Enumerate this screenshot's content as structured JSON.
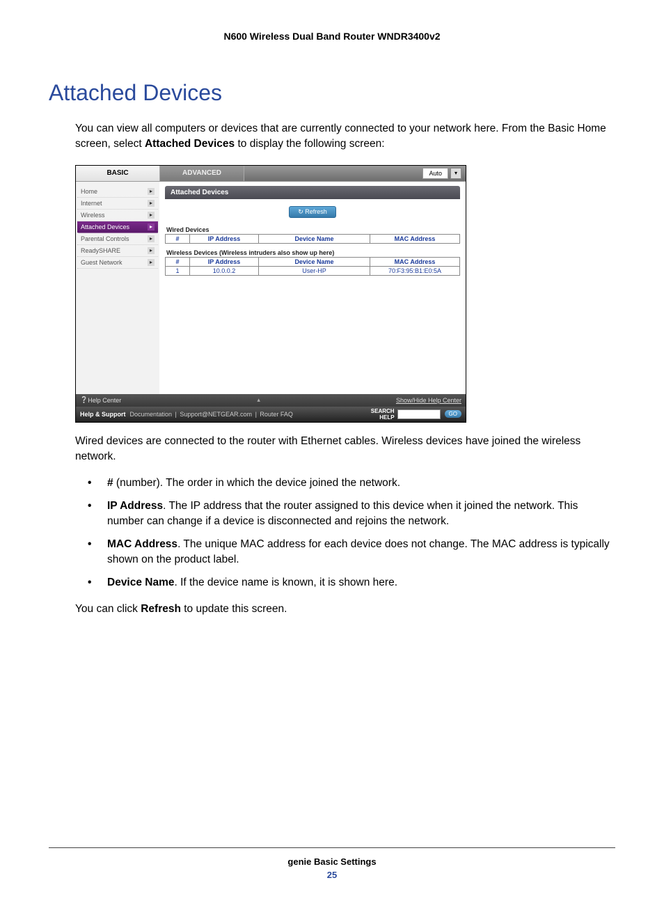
{
  "doc": {
    "header": "N600 Wireless Dual Band Router WNDR3400v2",
    "section_title": "Attached Devices",
    "intro_p1": "You can view all computers or devices that are currently connected to your network here. From the Basic Home screen, select ",
    "intro_bold": "Attached Devices",
    "intro_p2": " to display the following screen:",
    "after_fig": "Wired devices are connected to the router with Ethernet cables. Wireless devices have joined the wireless network.",
    "bullets": {
      "b1_bold": "#",
      "b1_rest": " (number). The order in which the device joined the network.",
      "b2_bold": "IP Address",
      "b2_rest": ". The IP address that the router assigned to this device when it joined the network. This number can change if a device is disconnected and rejoins the network.",
      "b3_bold": "MAC Address",
      "b3_rest": ". The unique MAC address for each device does not change. The MAC address is typically shown on the product label.",
      "b4_bold": "Device Name",
      "b4_rest": ". If the device name is known, it is shown here."
    },
    "closing_pre": "You can click ",
    "closing_bold": "Refresh",
    "closing_post": " to update this screen.",
    "footer_chapter": "genie Basic Settings",
    "footer_page": "25"
  },
  "ui": {
    "tabs": {
      "basic": "BASIC",
      "advanced": "ADVANCED"
    },
    "lang": "Auto",
    "sidebar": [
      {
        "label": "Home",
        "active": false
      },
      {
        "label": "Internet",
        "active": false
      },
      {
        "label": "Wireless",
        "active": false
      },
      {
        "label": "Attached Devices",
        "active": true
      },
      {
        "label": "Parental Controls",
        "active": false
      },
      {
        "label": "ReadySHARE",
        "active": false
      },
      {
        "label": "Guest Network",
        "active": false
      }
    ],
    "main_title": "Attached Devices",
    "refresh_label": "Refresh",
    "wired_label": "Wired Devices",
    "wireless_label": "Wireless Devices (Wireless intruders also show up here)",
    "cols": {
      "num": "#",
      "ip": "IP Address",
      "dev": "Device Name",
      "mac": "MAC Address"
    },
    "wireless_rows": [
      {
        "num": "1",
        "ip": "10.0.0.2",
        "dev": "User-HP",
        "mac": "70:F3:95:B1:E0:5A"
      }
    ],
    "helpbar": {
      "left": "Help Center",
      "right": "Show/Hide Help Center"
    },
    "footer": {
      "hs": "Help & Support",
      "doc": "Documentation",
      "sup": "Support@NETGEAR.com",
      "faq": "Router FAQ",
      "search": "SEARCH HELP",
      "go": "GO"
    }
  }
}
